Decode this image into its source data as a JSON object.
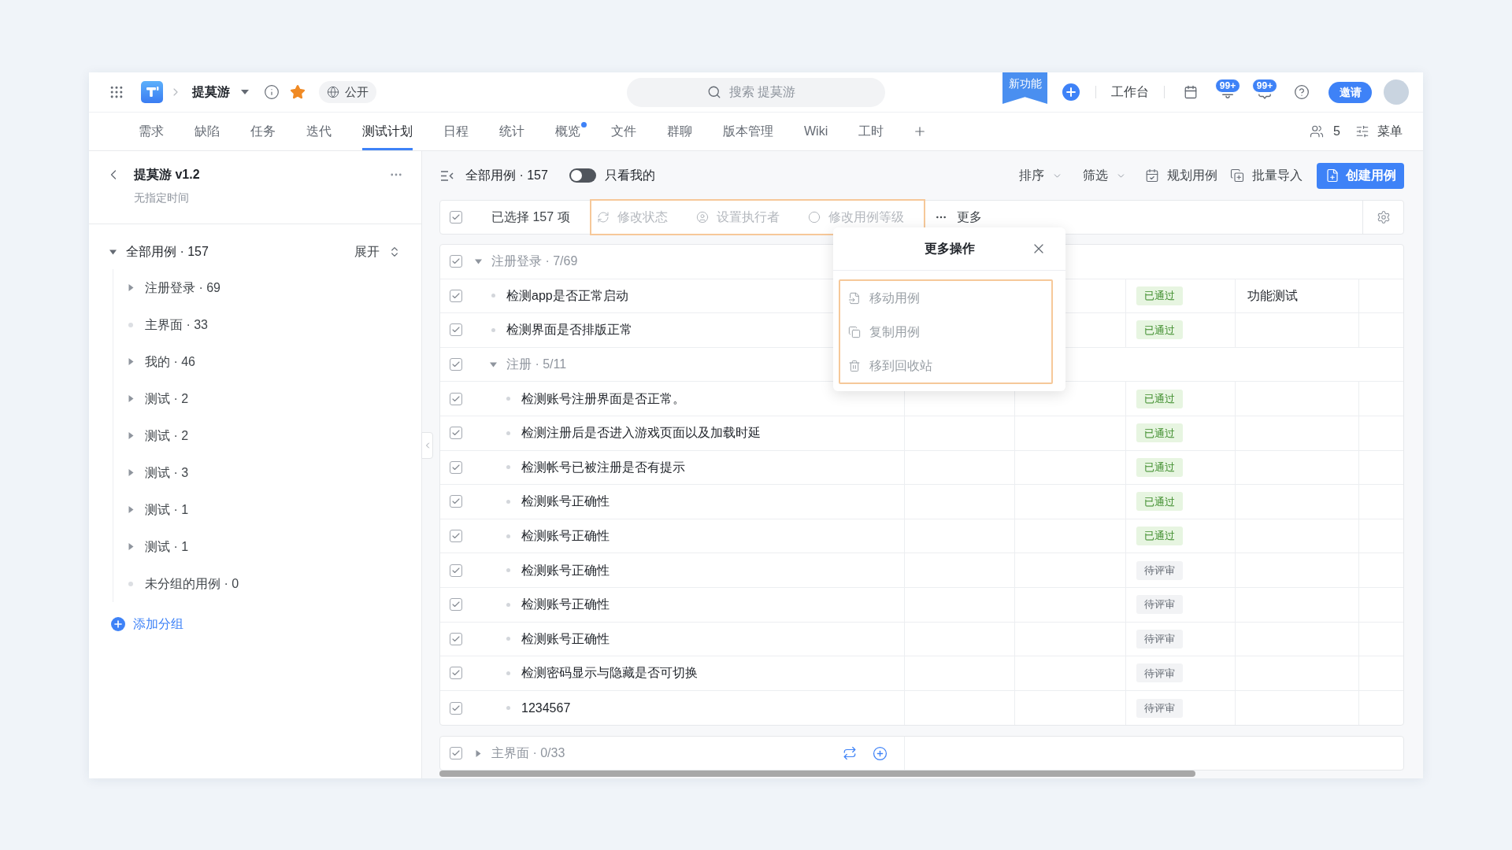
{
  "top_bar": {
    "project": "提莫游",
    "visibility": "公开",
    "search": {
      "placeholder": "搜索 提莫游"
    },
    "new_feature": "新功能",
    "workbench": "工作台",
    "notifications": [
      {
        "count": "99+"
      },
      {
        "count": "99+"
      }
    ],
    "invite": "邀请"
  },
  "tabs": [
    {
      "label": "需求",
      "selected": false,
      "dot": false
    },
    {
      "label": "缺陷",
      "selected": false,
      "dot": false
    },
    {
      "label": "任务",
      "selected": false,
      "dot": false
    },
    {
      "label": "迭代",
      "selected": false,
      "dot": false
    },
    {
      "label": "测试计划",
      "selected": true,
      "dot": false
    },
    {
      "label": "日程",
      "selected": false,
      "dot": false
    },
    {
      "label": "统计",
      "selected": false,
      "dot": false
    },
    {
      "label": "概览",
      "selected": false,
      "dot": true
    },
    {
      "label": "文件",
      "selected": false,
      "dot": false
    },
    {
      "label": "群聊",
      "selected": false,
      "dot": false
    },
    {
      "label": "版本管理",
      "selected": false,
      "dot": false
    },
    {
      "label": "Wiki",
      "selected": false,
      "dot": false
    },
    {
      "label": "工时",
      "selected": false,
      "dot": false
    }
  ],
  "tab_tools": {
    "members": "5",
    "menu": "菜单"
  },
  "sidebar": {
    "title": "提莫游 v1.2",
    "subtitle": "无指定时间",
    "tree": {
      "label": "全部用例 · 157",
      "expanded": true,
      "toggle": "展开",
      "children": [
        {
          "kind": "branch",
          "label": "注册登录 · 69",
          "expanded": false
        },
        {
          "kind": "leaf",
          "label": "主界面 · 33"
        },
        {
          "kind": "branch",
          "label": "我的 · 46",
          "expanded": false
        },
        {
          "kind": "branch",
          "label": "测试 · 2",
          "expanded": false
        },
        {
          "kind": "branch",
          "label": "测试 · 2",
          "expanded": false
        },
        {
          "kind": "branch",
          "label": "测试 · 3",
          "expanded": false
        },
        {
          "kind": "branch",
          "label": "测试 · 1",
          "expanded": false
        },
        {
          "kind": "branch",
          "label": "测试 · 1",
          "expanded": false
        },
        {
          "kind": "leaf",
          "label": "未分组的用例 · 0"
        }
      ]
    },
    "add_group": "添加分组"
  },
  "toolbar": {
    "view": "全部用例 · 157",
    "only_mine": {
      "label": "只看我的",
      "on": false
    },
    "sort": "排序",
    "filter": "筛选",
    "plan": "规划用例",
    "import": "批量导入",
    "create": "创建用例"
  },
  "selection_bar": {
    "checked": true,
    "count": "已选择 157 项",
    "actions": [
      {
        "label": "修改状态",
        "disabled": true
      },
      {
        "label": "设置执行者",
        "disabled": true
      },
      {
        "label": "修改用例等级",
        "disabled": true
      }
    ],
    "more": "更多"
  },
  "table": {
    "rows": [
      {
        "kind": "group",
        "label": "注册登录 · 7/69",
        "checked": true,
        "expanded": true,
        "children": [
          {
            "kind": "case",
            "title": "检测app是否正常启动",
            "checked": true,
            "status": {
              "label": "已通过",
              "kind": "passed"
            },
            "type": "功能测试"
          },
          {
            "kind": "case",
            "title": "检测界面是否排版正常",
            "checked": true,
            "status": {
              "label": "已通过",
              "kind": "passed"
            }
          },
          {
            "kind": "group",
            "label": "注册 · 5/11",
            "checked": true,
            "expanded": true,
            "children": [
              {
                "kind": "case",
                "title": "检测账号注册界面是否正常。",
                "checked": true,
                "status": {
                  "label": "已通过",
                  "kind": "passed"
                }
              },
              {
                "kind": "case",
                "title": "检测注册后是否进入游戏页面以及加载时延",
                "checked": true,
                "status": {
                  "label": "已通过",
                  "kind": "passed"
                }
              },
              {
                "kind": "case",
                "title": "检测帐号已被注册是否有提示",
                "checked": true,
                "status": {
                  "label": "已通过",
                  "kind": "passed"
                }
              },
              {
                "kind": "case",
                "title": "检测账号正确性",
                "checked": true,
                "status": {
                  "label": "已通过",
                  "kind": "passed"
                }
              },
              {
                "kind": "case",
                "title": "检测账号正确性",
                "checked": true,
                "status": {
                  "label": "已通过",
                  "kind": "passed"
                }
              },
              {
                "kind": "case",
                "title": "检测账号正确性",
                "checked": true,
                "status": {
                  "label": "待评审",
                  "kind": "pending"
                }
              },
              {
                "kind": "case",
                "title": "检测账号正确性",
                "checked": true,
                "status": {
                  "label": "待评审",
                  "kind": "pending"
                }
              },
              {
                "kind": "case",
                "title": "检测账号正确性",
                "checked": true,
                "status": {
                  "label": "待评审",
                  "kind": "pending"
                }
              },
              {
                "kind": "case",
                "title": "检测密码显示与隐藏是否可切换",
                "checked": true,
                "status": {
                  "label": "待评审",
                  "kind": "pending"
                }
              },
              {
                "kind": "case",
                "title": "1234567",
                "checked": true,
                "status": {
                  "label": "待评审",
                  "kind": "pending"
                }
              }
            ]
          }
        ]
      }
    ]
  },
  "footer_group": {
    "label": "主界面 · 0/33",
    "checked": true,
    "expanded": false
  },
  "popup": {
    "title": "更多操作",
    "items": [
      {
        "label": "移动用例",
        "disabled": true
      },
      {
        "label": "复制用例",
        "disabled": true
      },
      {
        "label": "移到回收站",
        "disabled": true
      }
    ]
  }
}
